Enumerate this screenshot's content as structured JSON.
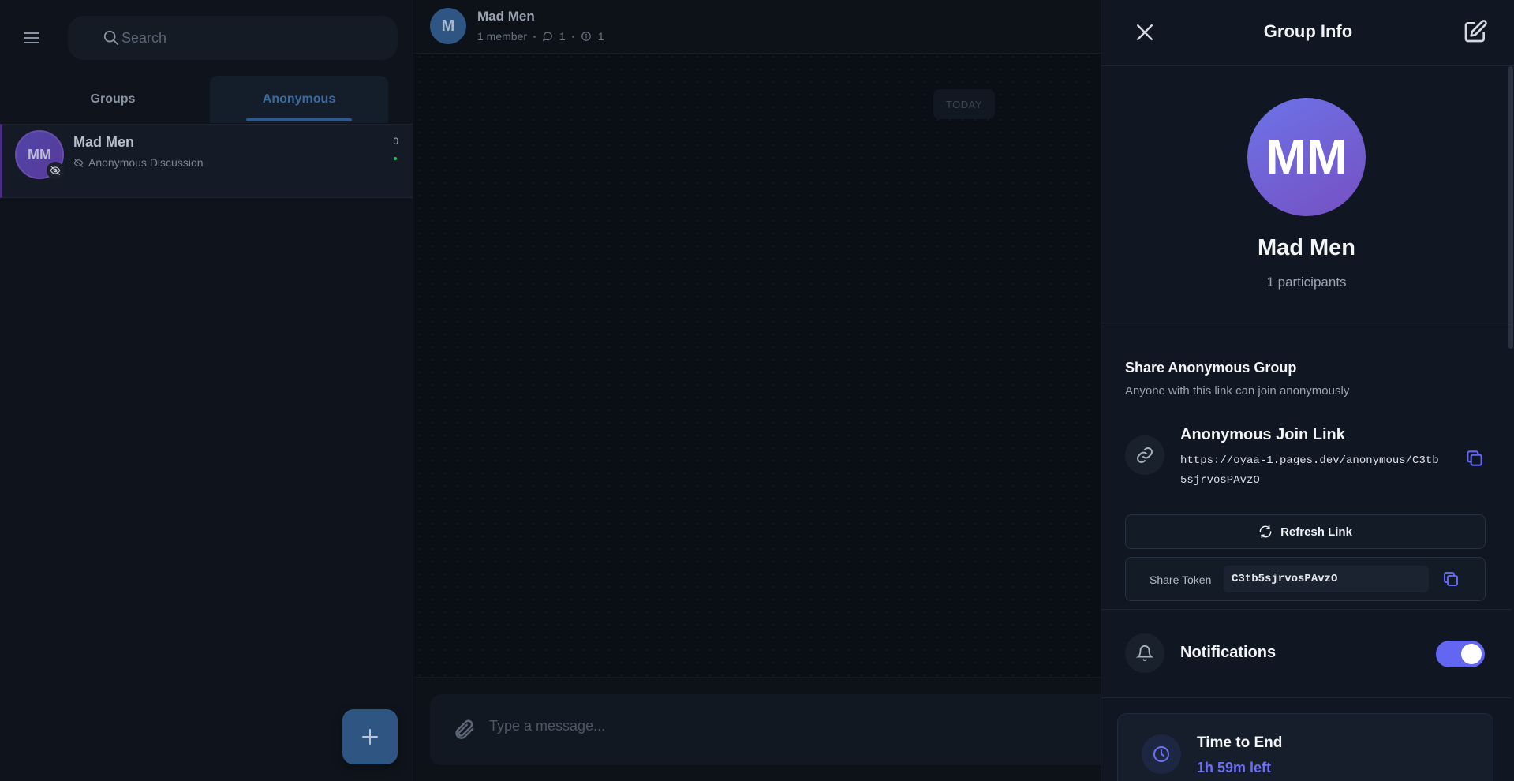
{
  "sidebar": {
    "search_placeholder": "Search",
    "tabs": [
      {
        "label": "Groups"
      },
      {
        "label": "Anonymous"
      }
    ],
    "chats": [
      {
        "initials": "MM",
        "name": "Mad Men",
        "subtitle": "Anonymous Discussion",
        "count": "0"
      }
    ]
  },
  "chat": {
    "avatar_letter": "M",
    "title": "Mad Men",
    "members": "1 member",
    "comments_count": "1",
    "info_count": "1",
    "date_divider": "TODAY",
    "composer_placeholder": "Type a message..."
  },
  "panel": {
    "title": "Group Info",
    "avatar_initials": "MM",
    "group_name": "Mad Men",
    "participants": "1 participants",
    "share_heading": "Share Anonymous Group",
    "share_description": "Anyone with this link can join anonymously",
    "join_link_label": "Anonymous Join Link",
    "join_link_url": "https://oyaa-1.pages.dev/anonymous/C3tb5sjrvosPAvzO",
    "refresh_label": "Refresh Link",
    "share_token_label": "Share Token",
    "share_token_value": "C3tb5sjrvosPAvzO",
    "notifications_label": "Notifications",
    "notifications_on": true,
    "time_to_end_label": "Time to End",
    "time_to_end_value": "1h 59m left"
  },
  "colors": {
    "accent": "#6366f1",
    "active_tab": "#3b6aa0",
    "time_value": "#6c6ff2"
  }
}
